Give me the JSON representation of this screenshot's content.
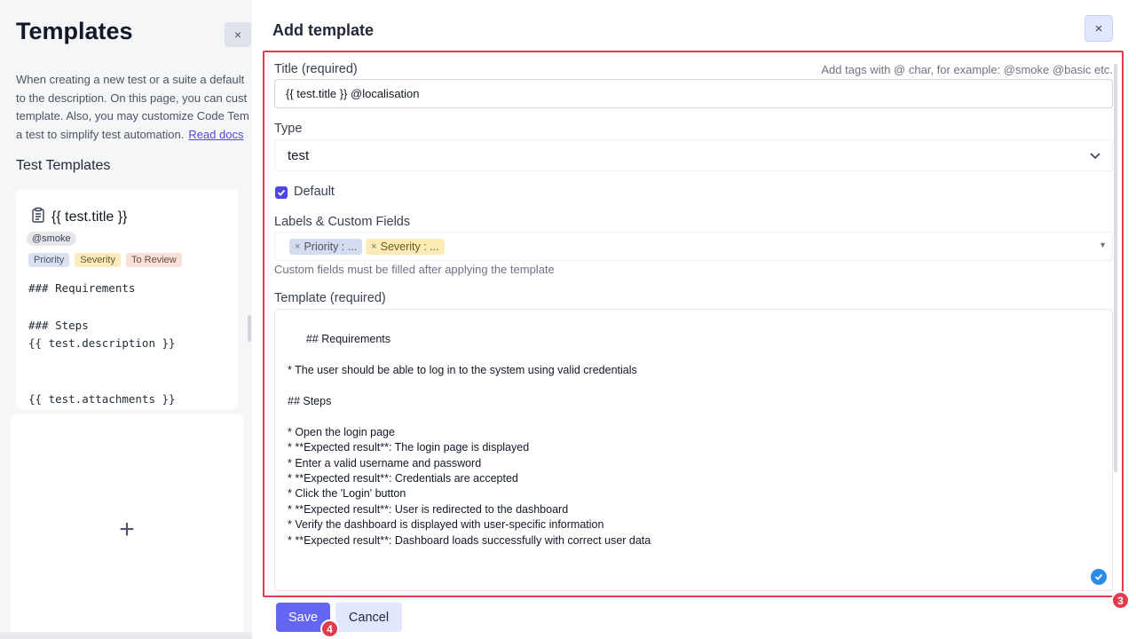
{
  "left": {
    "title": "Templates",
    "close_label": "×",
    "description_lines": [
      "When creating a new test or a suite a default",
      "to the description. On this page, you can cust",
      "template. Also, you may customize Code Tem",
      "a test to simplify test automation."
    ],
    "read_docs": "Read docs",
    "section_title": "Test Templates",
    "card": {
      "title": "{{ test.title }}",
      "tag": "@smoke",
      "chips": [
        "Priority",
        "Severity",
        "To Review"
      ],
      "code": "### Requirements\n\n### Steps\n{{ test.description }}\n\n\n{{ test.attachments }}"
    },
    "add_label": "+"
  },
  "modal": {
    "title": "Add template",
    "close_label": "×",
    "title_label": "Title (required)",
    "title_hint": "Add tags with @ char, for example: @smoke @basic etc.",
    "title_value": "{{ test.title }} @localisation",
    "type_label": "Type",
    "type_value": "test",
    "default_label": "Default",
    "labels_label": "Labels & Custom Fields",
    "labels": [
      "Priority : ...",
      "Severity : ..."
    ],
    "labels_help": "Custom fields must be filled after applying the template",
    "template_label": "Template (required)",
    "template_value": "## Requirements\n\n* The user should be able to log in to the system using valid credentials\n\n## Steps\n\n* Open the login page\n* **Expected result**: The login page is displayed\n* Enter a valid username and password\n* **Expected result**: Credentials are accepted\n* Click the 'Login' button\n* **Expected result**: User is redirected to the dashboard\n* Verify the dashboard is displayed with user-specific information\n* **Expected result**: Dashboard loads successfully with correct user data",
    "save_label": "Save",
    "cancel_label": "Cancel",
    "badge_form": "3",
    "badge_save": "4"
  },
  "colors": {
    "accent": "#6366f1",
    "highlight": "#e33b4b"
  }
}
